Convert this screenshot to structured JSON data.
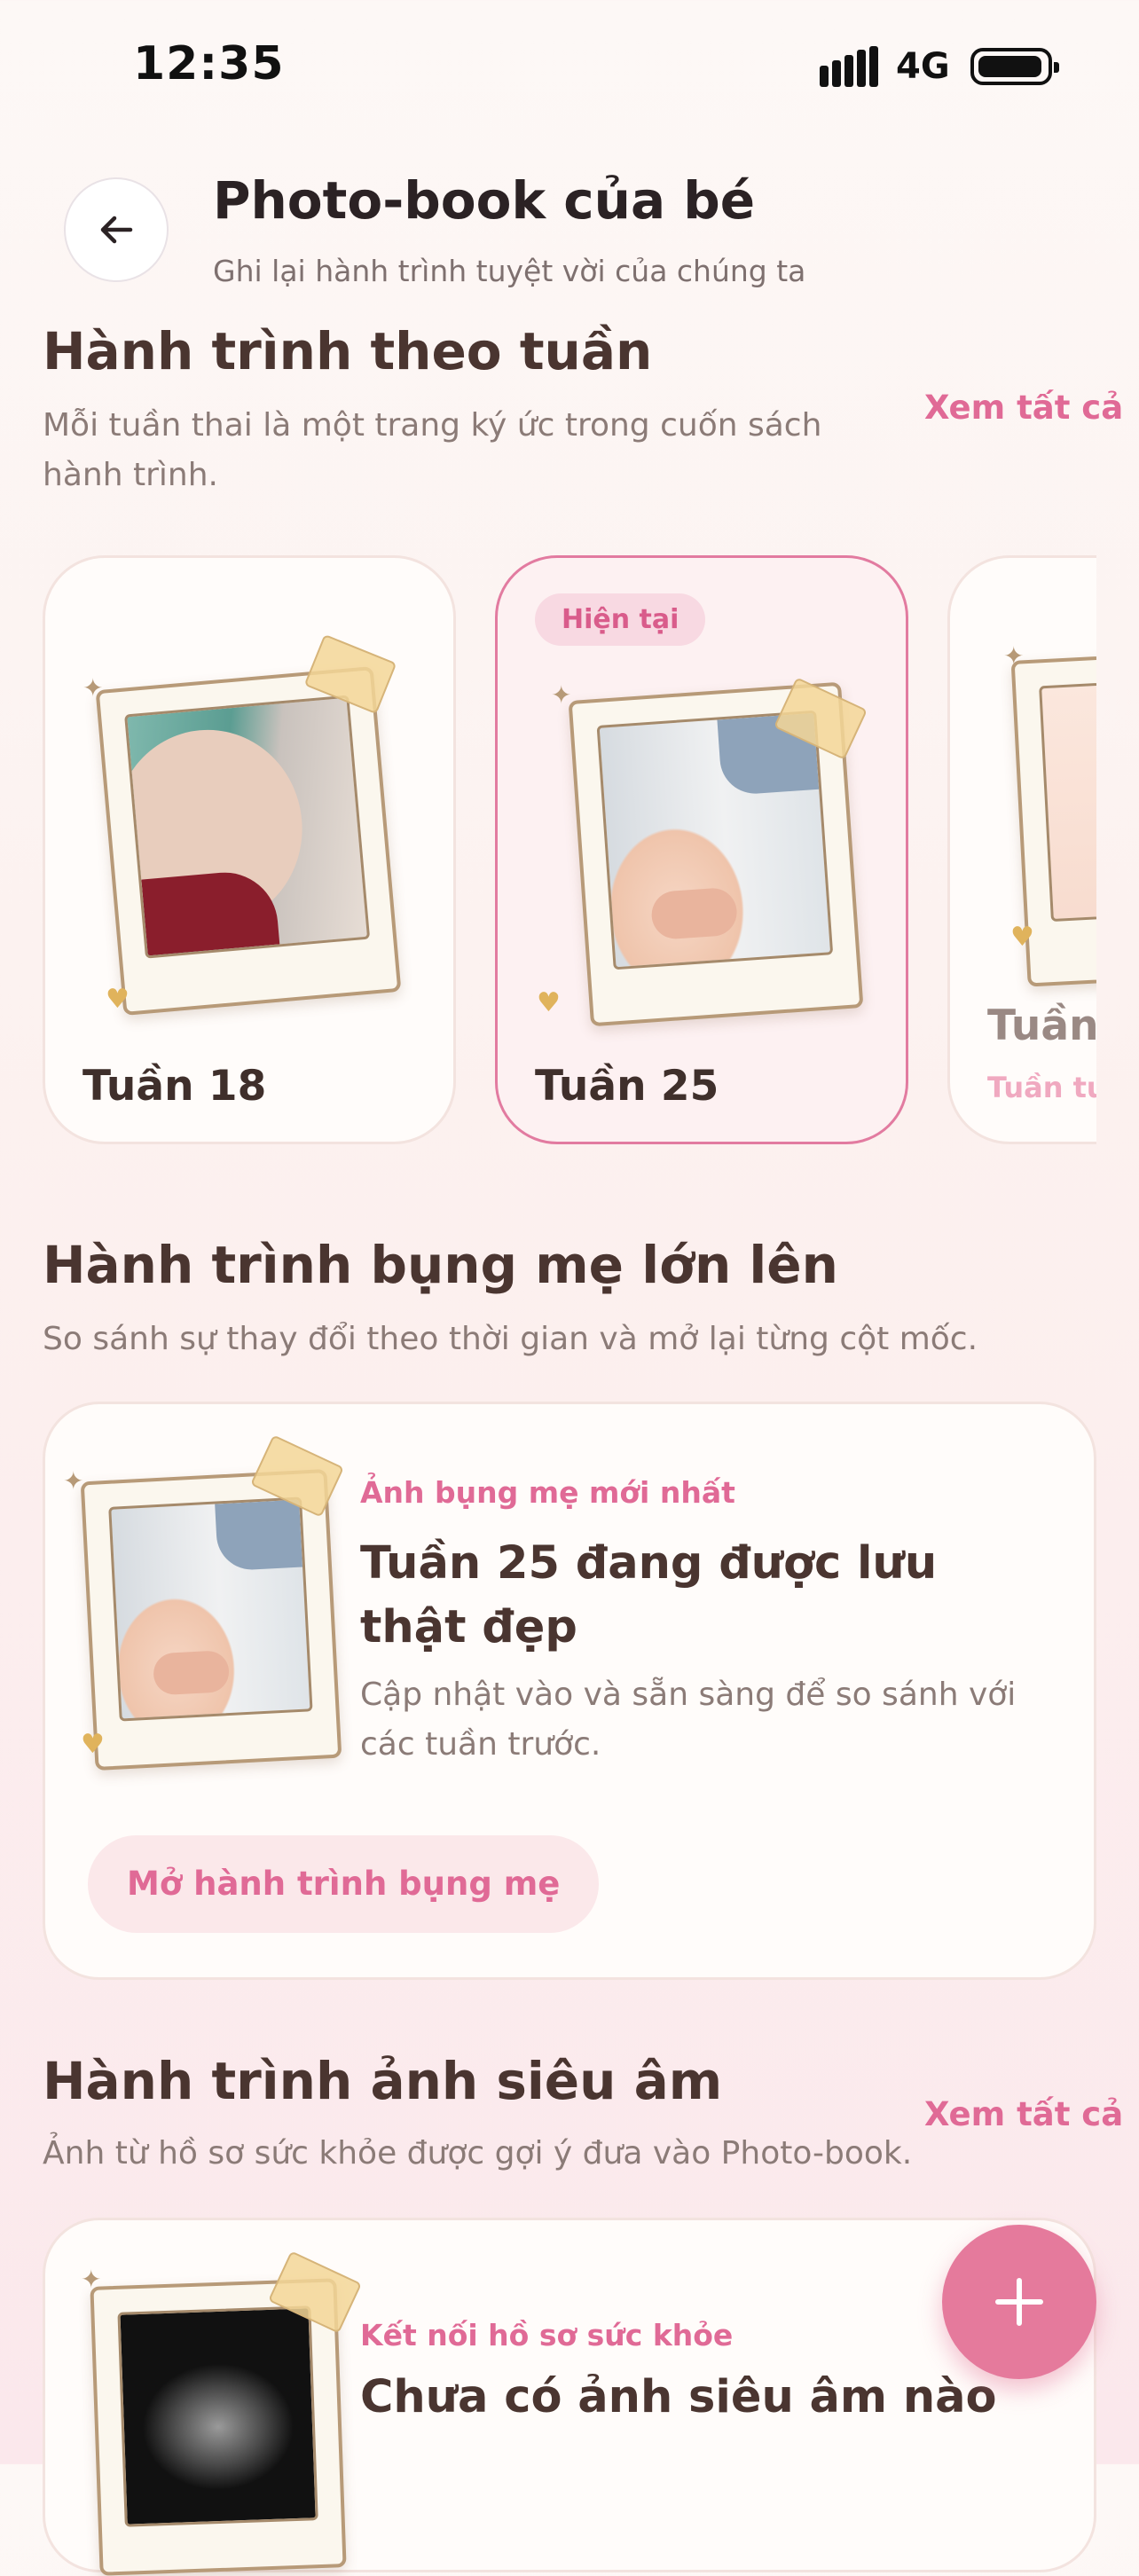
{
  "status_bar": {
    "time": "12:35",
    "network": "4G"
  },
  "header": {
    "title": "Photo-book của bé",
    "subtitle": "Ghi lại hành trình tuyệt vời của chúng ta"
  },
  "weekly": {
    "title": "Hành trình theo tuần",
    "description": "Mỗi tuần thai là một trang ký ức trong cuốn sách hành trình.",
    "see_all": "Xem tất cả",
    "cards": [
      {
        "label": "Tuần 18"
      },
      {
        "label": "Tuần 25",
        "badge": "Hiện tại"
      },
      {
        "label": "Tuần",
        "sublabel": "Tuần tư"
      }
    ]
  },
  "belly": {
    "title": "Hành trình bụng mẹ lớn lên",
    "description": "So sánh sự thay đổi theo thời gian và mở lại từng cột mốc.",
    "card": {
      "kicker": "Ảnh bụng mẹ mới nhất",
      "heading": "Tuần 25 đang được lưu thật đẹp",
      "body": "Cập nhật vào  và sẵn sàng để so sánh với các tuần trước.",
      "cta": "Mở hành trình bụng mẹ"
    }
  },
  "ultrasound": {
    "title": "Hành trình ảnh siêu âm",
    "description": "Ảnh từ hồ sơ sức khỏe được gợi ý đưa vào Photo-book.",
    "see_all": "Xem tất cả",
    "card": {
      "kicker": "Kết nối hồ sơ sức khỏe",
      "heading": "Chưa có ảnh siêu âm nào"
    }
  },
  "fab": {
    "icon": "plus-icon"
  },
  "colors": {
    "accent": "#e06a96",
    "fab": "#e57a9c",
    "text": "#4a3530"
  }
}
